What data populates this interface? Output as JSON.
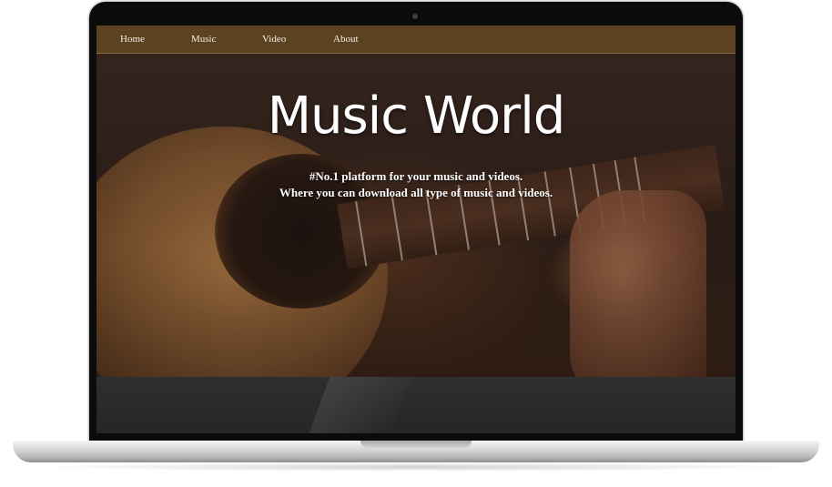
{
  "nav": {
    "items": [
      {
        "label": "Home"
      },
      {
        "label": "Music"
      },
      {
        "label": "Video"
      },
      {
        "label": "About"
      }
    ]
  },
  "hero": {
    "title": "Music World",
    "tagline_line1": "#No.1 platform for your music and videos.",
    "tagline_line2": "Where you can download all type of music and videos.",
    "background_image": "guitar-playing-photo"
  },
  "colors": {
    "navbar": "#5c4220",
    "nav_text": "#f3ede2",
    "title_text": "#ffffff",
    "lower_band": "#2b2b2b"
  }
}
